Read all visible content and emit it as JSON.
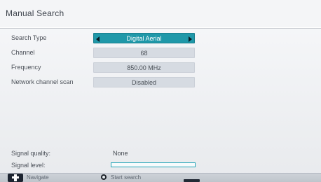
{
  "window": {
    "title": "Manual Search"
  },
  "settings": [
    {
      "label": "Search Type",
      "value": "Digital Aerial",
      "selected": true,
      "has_arrows": true
    },
    {
      "label": "Channel",
      "value": "68",
      "selected": false,
      "has_arrows": false
    },
    {
      "label": "Frequency",
      "value": "850.00 MHz",
      "selected": false,
      "has_arrows": false
    },
    {
      "label": "Network channel scan",
      "value": "Disabled",
      "selected": false,
      "has_arrows": false
    }
  ],
  "status": {
    "signal_quality_label": "Signal quality:",
    "signal_quality_value": "None",
    "signal_level_label": "Signal level:",
    "signal_level_value": 0
  },
  "footer": {
    "navigate_label": "Navigate",
    "start_search_label": "Start search"
  },
  "icons": {
    "navigate": "dpad-icon",
    "ok": "ok-button-icon",
    "left": "left-arrow-icon",
    "right": "right-arrow-icon"
  },
  "colors": {
    "selected": "#1f98a9",
    "panel": "#d6dbe2",
    "signal_border": "#22a5b7",
    "footer_text": "#5e6670"
  }
}
